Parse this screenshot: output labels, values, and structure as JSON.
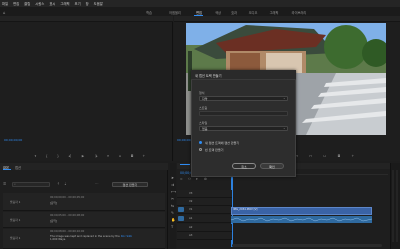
{
  "menu": [
    "파일",
    "편집",
    "클립",
    "시퀀스",
    "표시",
    "그래픽",
    "보기",
    "창",
    "도움말"
  ],
  "workspace_tabs": {
    "learning": "학습",
    "assembly": "어셈블리",
    "editing": "편집",
    "color": "색상",
    "effects": "효과",
    "audio": "오디오",
    "captions": "그래픽",
    "libraries": "라이브러리"
  },
  "source_monitor": {
    "timecode": "00;00;00;00"
  },
  "program_monitor": {
    "timecode": "00;00;00;00"
  },
  "dialog": {
    "title": "새 캡션 트랙 만들기",
    "format_label": "형식",
    "format_value": "자막",
    "standard_label": "스트림",
    "standard_value": "",
    "style_label": "스타일",
    "style_value": "없음",
    "option1": "새 캡션 트랙에 캡션 만들기",
    "option2": "빈 트랙 만들기",
    "cancel": "취소",
    "ok": "확인"
  },
  "captions_panel": {
    "tab1": "대본",
    "tab2": "캡션",
    "create_button": "캡션 만들기",
    "items": [
      {
        "speaker": "발표자 1",
        "timecode": "00;00;00;00 - 00;00;05;00",
        "text": "[음악]"
      },
      {
        "speaker": "발표자 1",
        "timecode": "00;00;05;00 - 00;00;08;00",
        "text": "[음악]"
      },
      {
        "speaker": "발표자 1",
        "timecode": "00;00;08;00 - 00;00;10;00",
        "text": "The image was kept and replaced in the scene by the",
        "link": "Doc Sikb",
        "text2": "1,000 Ways."
      }
    ]
  },
  "timeline": {
    "timecode": "00;00;00;00",
    "clip_name": "IMG_2034.MOV [V]",
    "tracks": [
      "V3",
      "V2",
      "V1",
      "A1",
      "A2",
      "A3"
    ]
  },
  "colors": {
    "accent": "#2f8cf3",
    "clip": "#3a63a6"
  }
}
